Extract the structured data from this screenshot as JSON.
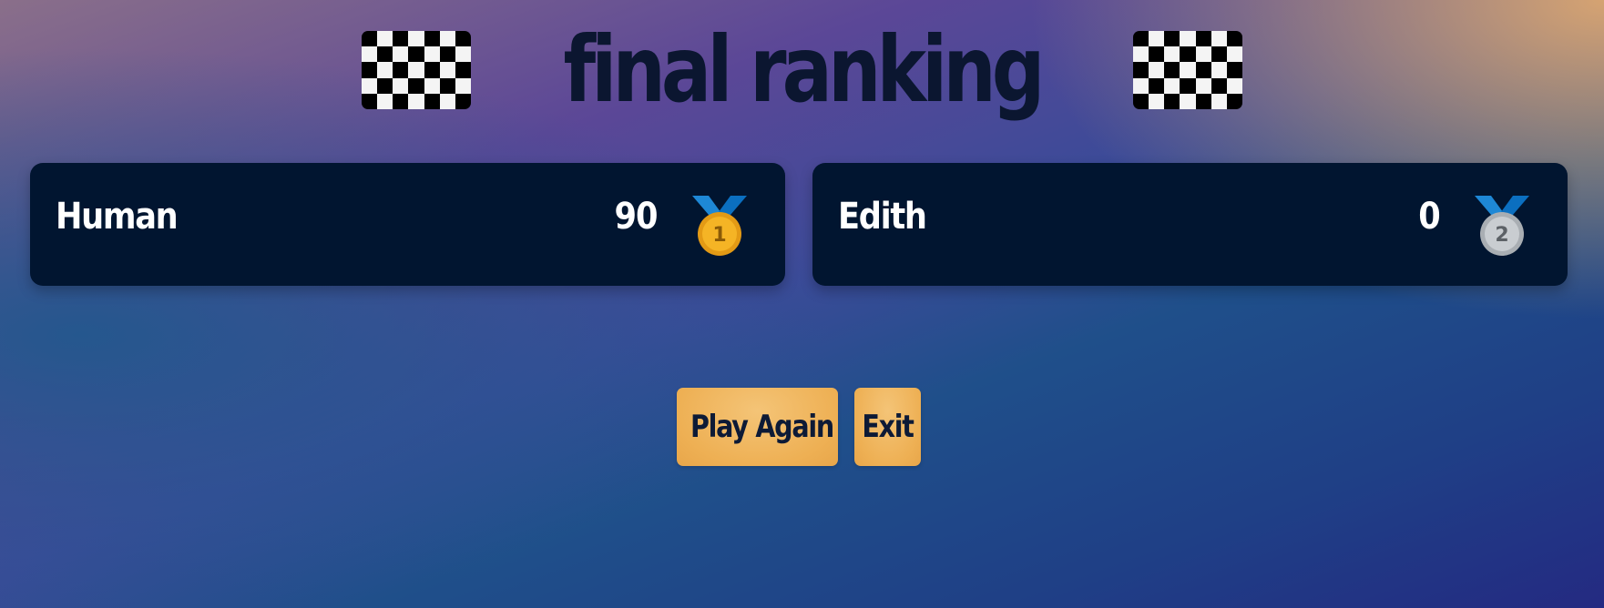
{
  "header": {
    "title": "final ranking",
    "flag_icon": "checkered-flag-icon"
  },
  "players": [
    {
      "name": "Human",
      "score": "90",
      "rank": "1",
      "medal_icon": "gold-medal-icon",
      "medal_color": "#f5b425"
    },
    {
      "name": "Edith",
      "score": "0",
      "rank": "2",
      "medal_icon": "silver-medal-icon",
      "medal_color": "#c9cdd1"
    }
  ],
  "actions": {
    "play_again_label": "Play Again",
    "exit_label": "Exit"
  },
  "colors": {
    "card_background": "#011530",
    "button_background": "#eeb054",
    "title_color": "#0b1630"
  }
}
